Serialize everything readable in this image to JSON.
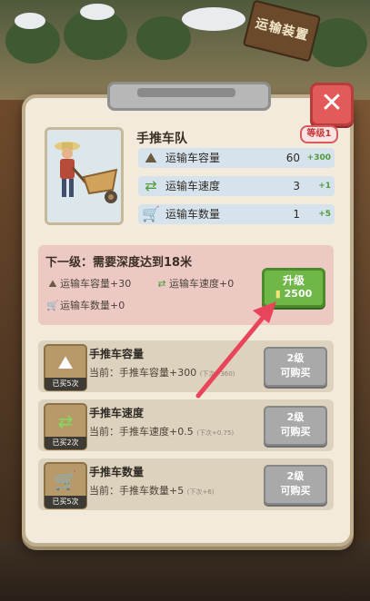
{
  "scene": {
    "sign_text": "运输装置"
  },
  "header": {
    "title": "手推车队",
    "level_badge": "等级1"
  },
  "stats": [
    {
      "icon": "capacity-icon",
      "label": "运输车容量",
      "value": "60",
      "bonus": "+300"
    },
    {
      "icon": "speed-icon",
      "label": "运输车速度",
      "value": "3",
      "bonus": "+1"
    },
    {
      "icon": "cart-icon",
      "label": "运输车数量",
      "value": "1",
      "bonus": "+5"
    }
  ],
  "next_level": {
    "title": "下一级：需要深度达到18米",
    "items": [
      {
        "icon": "capacity-icon",
        "text": "运输车容量+30"
      },
      {
        "icon": "speed-icon",
        "text": "运输车速度+0"
      },
      {
        "icon": "cart-icon",
        "text": "运输车数量+0"
      }
    ],
    "upgrade_label": "升级",
    "upgrade_cost": "2500"
  },
  "upgrades": [
    {
      "icon": "capacity-icon",
      "bought": "已买5次",
      "name": "手推车容量",
      "current": "当前：手推车容量+300",
      "next": "(下次+360)",
      "btn_line1": "2级",
      "btn_line2": "可购买"
    },
    {
      "icon": "speed-icon",
      "bought": "已买2次",
      "name": "手推车速度",
      "current": "当前：手推车速度+0.5",
      "next": "(下次+0.75)",
      "btn_line1": "2级",
      "btn_line2": "可购买"
    },
    {
      "icon": "cart-icon",
      "bought": "已买5次",
      "name": "手推车数量",
      "current": "当前：手推车数量+5",
      "next": "(下次+6)",
      "btn_line1": "2级",
      "btn_line2": "可购买"
    }
  ],
  "colors": {
    "upgrade_green": "#6fb847",
    "close_red": "#e25a5a",
    "arrow_red": "#e8455a",
    "badge_red": "#d75b5b"
  }
}
